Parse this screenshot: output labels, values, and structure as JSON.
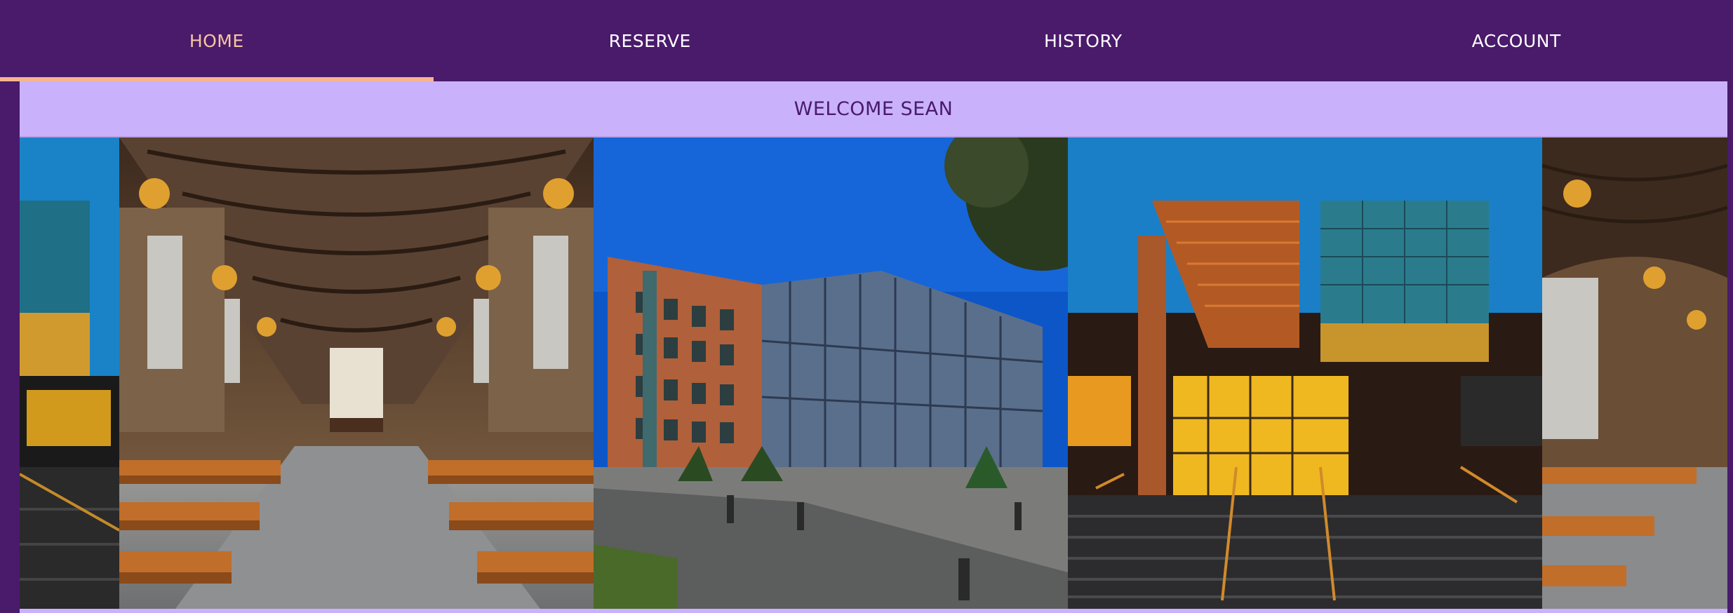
{
  "nav": {
    "tabs": [
      {
        "label": "HOME",
        "active": true
      },
      {
        "label": "RESERVE",
        "active": false
      },
      {
        "label": "HISTORY",
        "active": false
      },
      {
        "label": "ACCOUNT",
        "active": false
      }
    ]
  },
  "banner": {
    "text": "WELCOME SEAN"
  },
  "carousel": {
    "slides": [
      "reading-hall-photo",
      "brick-glass-building-photo",
      "modern-building-stairs-photo"
    ]
  },
  "colors": {
    "nav_bg": "#4a1a6b",
    "banner_bg": "#c9b2fb",
    "active_tab": "#f5c6a0"
  }
}
